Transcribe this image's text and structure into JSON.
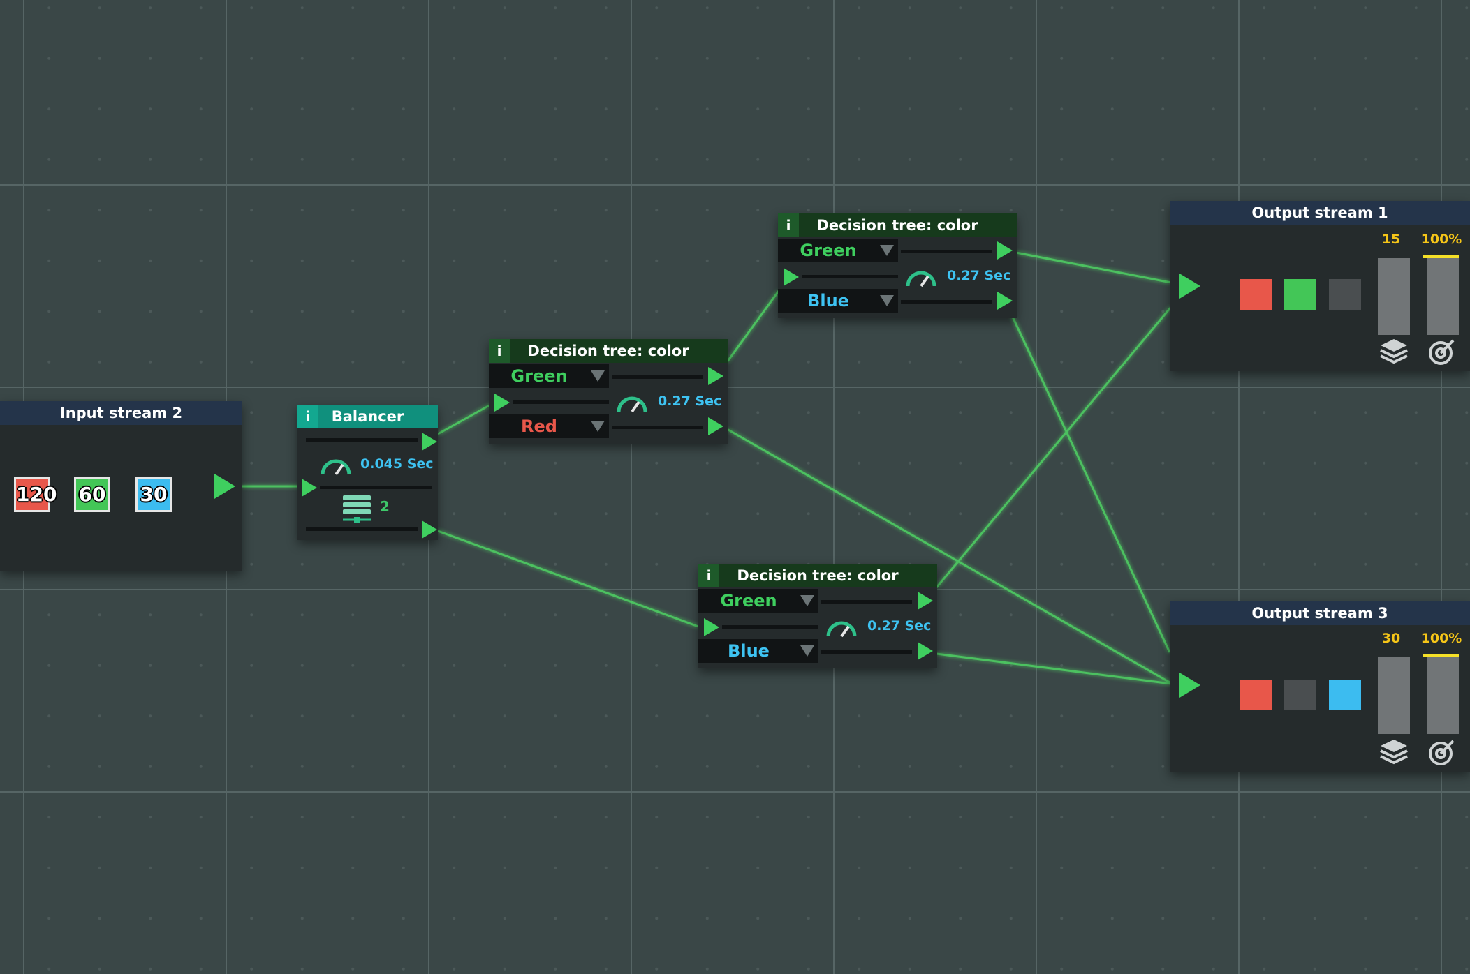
{
  "colors": {
    "green": "#3fcf5f",
    "red": "#e8574a",
    "blue": "#3ec3f2",
    "grey": "#4a4e50",
    "accent_yellow": "#f5c518"
  },
  "input_stream": {
    "title": "Input stream 2",
    "chips": [
      {
        "value": "120",
        "color": "#e8574a"
      },
      {
        "value": "60",
        "color": "#43c657"
      },
      {
        "value": "30",
        "color": "#3cbcf0"
      }
    ]
  },
  "balancer": {
    "info": "i",
    "title": "Balancer",
    "speed": "0.045 Sec",
    "count": "2",
    "icons": [
      "speed-gauge-icon",
      "server-stack-icon"
    ]
  },
  "decision_trees": [
    {
      "info": "i",
      "title": "Decision tree: color",
      "top_option": "Green",
      "bottom_option": "Red",
      "speed": "0.27 Sec"
    },
    {
      "info": "i",
      "title": "Decision tree: color",
      "top_option": "Green",
      "bottom_option": "Blue",
      "speed": "0.27 Sec"
    },
    {
      "info": "i",
      "title": "Decision tree: color",
      "top_option": "Green",
      "bottom_option": "Blue",
      "speed": "0.27 Sec"
    }
  ],
  "output_streams": [
    {
      "title": "Output stream 1",
      "count": "15",
      "percent": "100%",
      "percent_value": 1.0,
      "squares": [
        "#e8574a",
        "#43c657",
        "#4a4e50"
      ],
      "icons": [
        "layers-icon",
        "target-icon"
      ]
    },
    {
      "title": "Output stream 3",
      "count": "30",
      "percent": "100%",
      "percent_value": 1.0,
      "squares": [
        "#e8574a",
        "#4a4e50",
        "#3cbcf0"
      ],
      "icons": [
        "layers-icon",
        "target-icon"
      ]
    }
  ]
}
